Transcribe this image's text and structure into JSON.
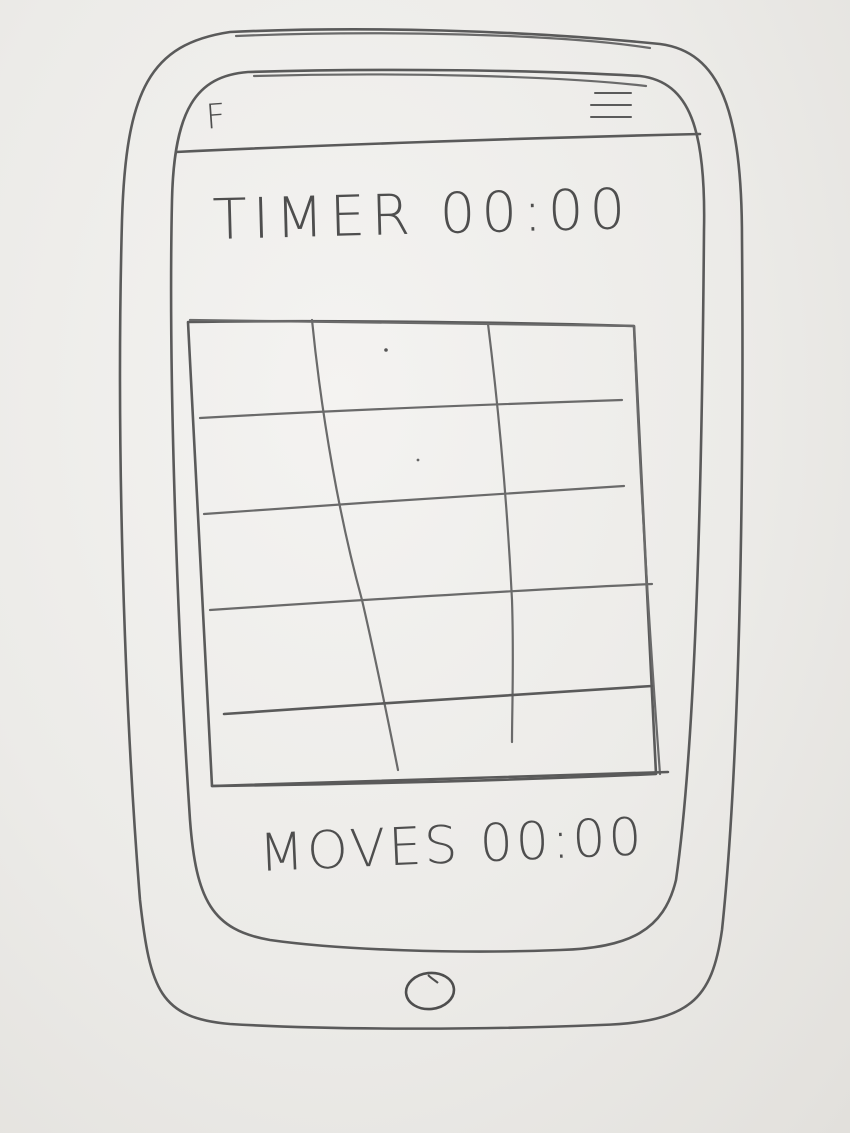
{
  "header": {
    "logo_text": "F",
    "menu_icon": "hamburger-menu-icon"
  },
  "timer": {
    "label": "TIMER",
    "value": "00:00",
    "text": "TIMER 00:00"
  },
  "board": {
    "rows": 5,
    "columns": 3
  },
  "moves": {
    "label": "MOVES",
    "value": "00:00",
    "text": "MOVES 00:00"
  },
  "device": {
    "home_button_icon": "home-button-icon"
  }
}
